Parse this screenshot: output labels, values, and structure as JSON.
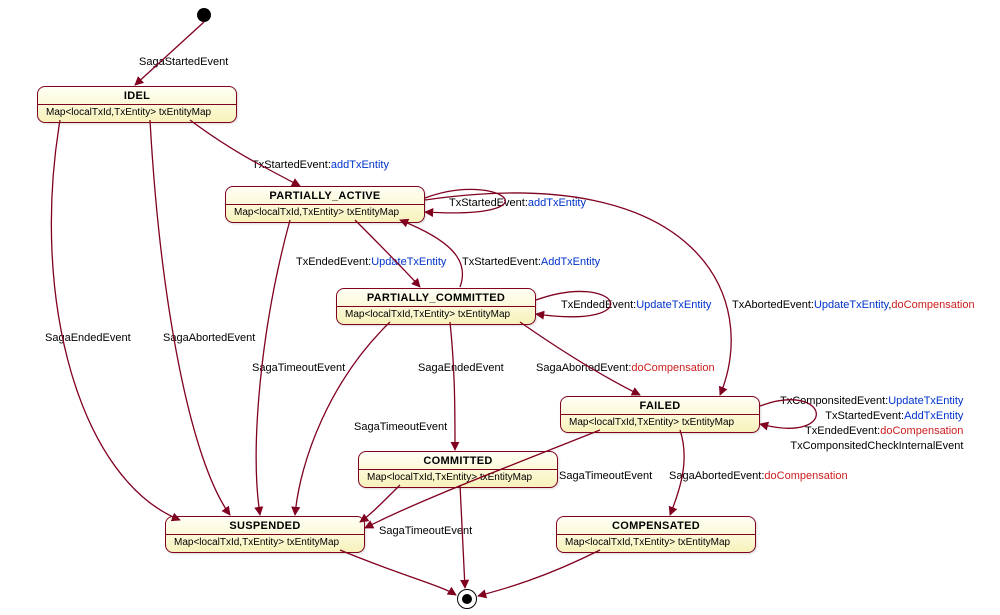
{
  "states": {
    "idel": {
      "title": "IDEL",
      "body": "Map<localTxId,TxEntity> txEntityMap"
    },
    "pactive": {
      "title": "PARTIALLY_ACTIVE",
      "body": "Map<localTxId,TxEntity> txEntityMap"
    },
    "pcommit": {
      "title": "PARTIALLY_COMMITTED",
      "body": "Map<localTxId,TxEntity> txEntityMap"
    },
    "failed": {
      "title": "FAILED",
      "body": "Map<localTxId,TxEntity> txEntityMap"
    },
    "committed": {
      "title": "COMMITTED",
      "body": "Map<localTxId,TxEntity> txEntityMap"
    },
    "suspended": {
      "title": "SUSPENDED",
      "body": "Map<localTxId,TxEntity> txEntityMap"
    },
    "compensated": {
      "title": "COMPENSATED",
      "body": "Map<localTxId,TxEntity> txEntityMap"
    }
  },
  "labels": {
    "sagaStarted": "SagaStartedEvent",
    "txStartedAdd": "TxStartedEvent:",
    "addTxEntity": "addTxEntity",
    "txStartedAdd2": "TxStartedEvent:",
    "addTxEntityCap": "AddTxEntity",
    "txEndedUpdate": "TxEndedEvent:",
    "updateTxEntity": "UpdateTxEntity",
    "sagaEnded": "SagaEndedEvent",
    "sagaAborted": "SagaAbortedEvent",
    "sagaTimeout": "SagaTimeoutEvent",
    "sagaAbortedDo": "SagaAbortedEvent:",
    "doComp": "doCompensation",
    "txAborted": "TxAbortedEvent:",
    "txComposited": "TxComponsitedEvent:",
    "txCompositedCheck": "TxComponsitedCheckInternalEvent"
  }
}
